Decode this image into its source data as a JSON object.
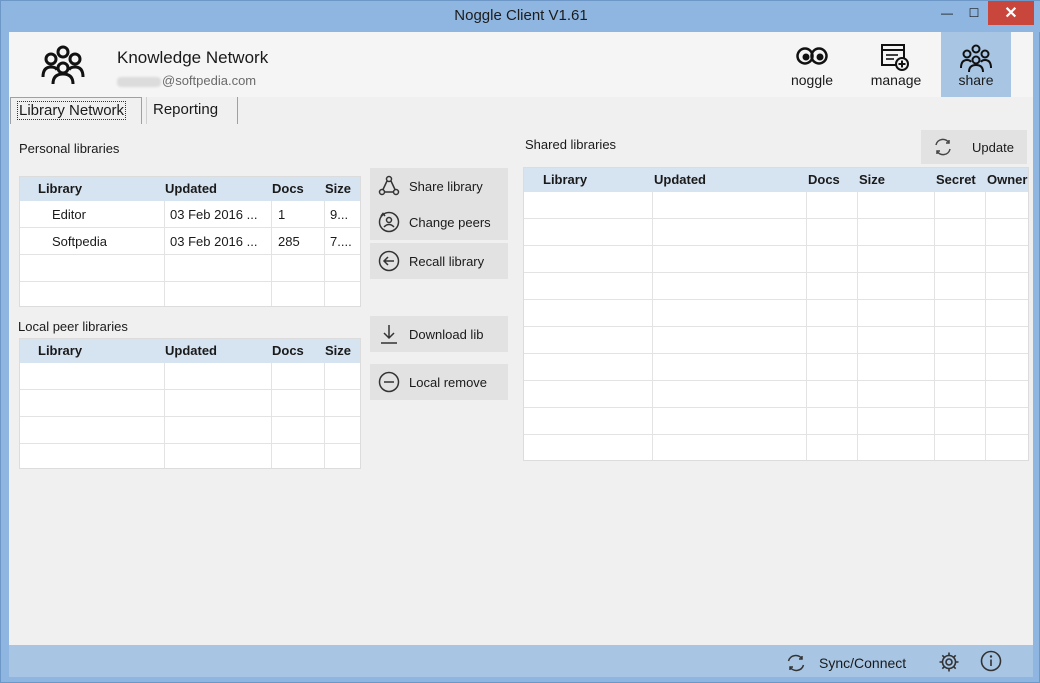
{
  "window": {
    "title": "Noggle Client V1.61",
    "minimize": "—",
    "maximize": "☐",
    "close": "✕"
  },
  "header": {
    "title": "Knowledge Network",
    "email_suffix": "@softpedia.com",
    "nav": [
      {
        "label": "noggle",
        "icon": "eyes-icon"
      },
      {
        "label": "manage",
        "icon": "manage-icon"
      },
      {
        "label": "share",
        "icon": "people-icon",
        "active": true
      }
    ]
  },
  "tabs": [
    "Library Network",
    "Reporting"
  ],
  "personal": {
    "label": "Personal libraries",
    "columns": [
      "Library",
      "Updated",
      "Docs",
      "Size"
    ],
    "rows": [
      {
        "library": "Editor",
        "updated": "03 Feb 2016 ...",
        "docs": "1",
        "size": "9..."
      },
      {
        "library": "Softpedia",
        "updated": "03 Feb 2016 ...",
        "docs": "285",
        "size": "7...."
      }
    ]
  },
  "local": {
    "label": "Local peer libraries",
    "columns": [
      "Library",
      "Updated",
      "Docs",
      "Size"
    ]
  },
  "actions": {
    "share": "Share library",
    "change_peers": "Change peers",
    "recall": "Recall library",
    "download": "Download lib",
    "local_remove": "Local remove"
  },
  "shared": {
    "label": "Shared libraries",
    "update": "Update",
    "columns": [
      "Library",
      "Updated",
      "Docs",
      "Size",
      "Secret",
      "Owner"
    ]
  },
  "status": {
    "sync": "Sync/Connect"
  },
  "colors": {
    "accent": "#8fb6e0",
    "selected_nav": "#a8c6e4",
    "grid_header": "#d6e4f2",
    "close": "#c9463d"
  }
}
